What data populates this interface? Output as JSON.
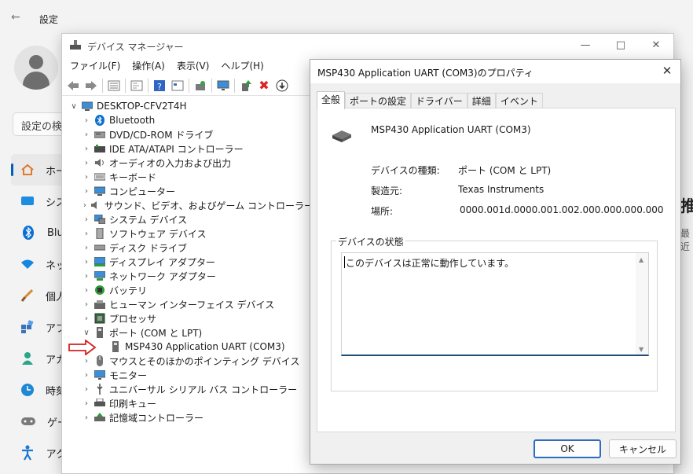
{
  "settings": {
    "title": "設定",
    "search_placeholder": "設定の検",
    "nav": [
      {
        "label": "ホー",
        "icon": "home-icon"
      },
      {
        "label": "シス",
        "icon": "system-icon"
      },
      {
        "label": "Blu",
        "icon": "bluetooth-icon"
      },
      {
        "label": "ネッ",
        "icon": "wifi-icon"
      },
      {
        "label": "個人",
        "icon": "brush-icon"
      },
      {
        "label": "アプ",
        "icon": "apps-icon"
      },
      {
        "label": "アカ",
        "icon": "account-icon"
      },
      {
        "label": "時刻",
        "icon": "clock-icon"
      },
      {
        "label": "ゲー",
        "icon": "gamepad-icon"
      },
      {
        "label": "アク",
        "icon": "accessibility-icon"
      }
    ],
    "right_heading": "推",
    "right_sub": "最近"
  },
  "devmgr": {
    "title": "デバイス マネージャー",
    "menu": [
      "ファイル(F)",
      "操作(A)",
      "表示(V)",
      "ヘルプ(H)"
    ],
    "root": "DESKTOP-CFV2T4H",
    "categories": [
      "Bluetooth",
      "DVD/CD-ROM ドライブ",
      "IDE ATA/ATAPI コントローラー",
      "オーディオの入力および出力",
      "キーボード",
      "コンピューター",
      "サウンド、ビデオ、およびゲーム コントローラー",
      "システム デバイス",
      "ソフトウェア デバイス",
      "ディスク ドライブ",
      "ディスプレイ アダプター",
      "ネットワーク アダプター",
      "バッテリ",
      "ヒューマン インターフェイス デバイス",
      "プロセッサ",
      "ポート (COM と LPT)",
      "MSP430 Application UART (COM3)",
      "マウスとそのほかのポインティング デバイス",
      "モニター",
      "ユニバーサル シリアル バス コントローラー",
      "印刷キュー",
      "記憶域コントローラー"
    ]
  },
  "props": {
    "title": "MSP430 Application UART (COM3)のプロパティ",
    "tabs": [
      "全般",
      "ポートの設定",
      "ドライバー",
      "詳細",
      "イベント"
    ],
    "device_name": "MSP430 Application UART (COM3)",
    "type_label": "デバイスの種類:",
    "type_value": "ポート (COM と LPT)",
    "mfr_label": "製造元:",
    "mfr_value": "Texas Instruments",
    "loc_label": "場所:",
    "loc_value": "0000.001d.0000.001.002.000.000.000.000",
    "status_title": "デバイスの状態",
    "status_text": "このデバイスは正常に動作しています。",
    "ok": "OK",
    "cancel": "キャンセル"
  },
  "colors": {
    "accent": "#005fb8",
    "arrow": "#d32020"
  }
}
